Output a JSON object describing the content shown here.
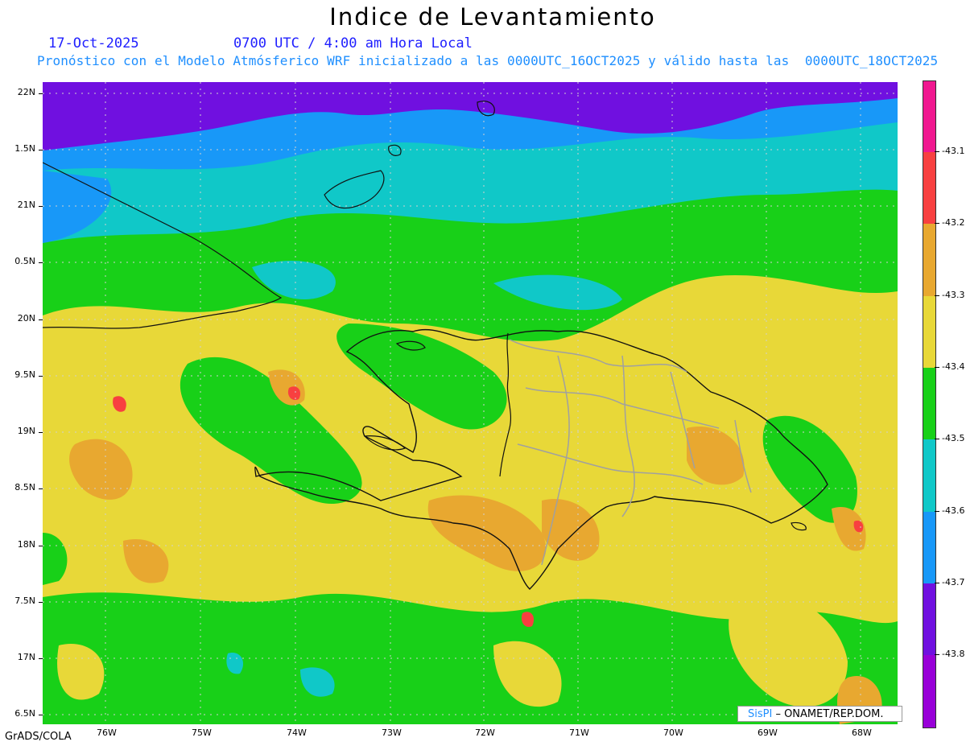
{
  "title": "Indice de Levantamiento",
  "date_line": "17-Oct-2025",
  "time_line": "0700 UTC / 4:00 am Hora Local",
  "model_line": "Pronóstico con el Modelo Atmósferico WRF inicializado a las 0000UTC_16OCT2025 y válido hasta las  0000UTC_18OCT2025",
  "lat_labels": [
    "22N",
    "1.5N",
    "21N",
    "0.5N",
    "20N",
    "9.5N",
    "19N",
    "8.5N",
    "18N",
    "7.5N",
    "17N",
    "6.5N"
  ],
  "lon_labels": [
    "76W",
    "75W",
    "74W",
    "73W",
    "72W",
    "71W",
    "70W",
    "69W",
    "68W"
  ],
  "colorbar": {
    "labels": [
      "-43.1",
      "-43.2",
      "-43.3",
      "-43.4",
      "-43.5",
      "-43.6",
      "-43.7",
      "-43.8"
    ],
    "colors": [
      "#f01890",
      "#f84040",
      "#e8a830",
      "#e8d838",
      "#18d018",
      "#10c8c8",
      "#1898f8",
      "#7010e0",
      "#9800d8"
    ]
  },
  "colors": {
    "purple": "#9000d8",
    "blue": "#1898f8",
    "cyan": "#10c8c8",
    "green": "#18d018",
    "yellow": "#e8d838",
    "orange": "#e8a830",
    "red": "#f84040",
    "magenta": "#f01890"
  },
  "credit": {
    "brand": "SisPI",
    "text": " – ONAMET/REP.DOM."
  },
  "software": "GrADS/COLA"
}
